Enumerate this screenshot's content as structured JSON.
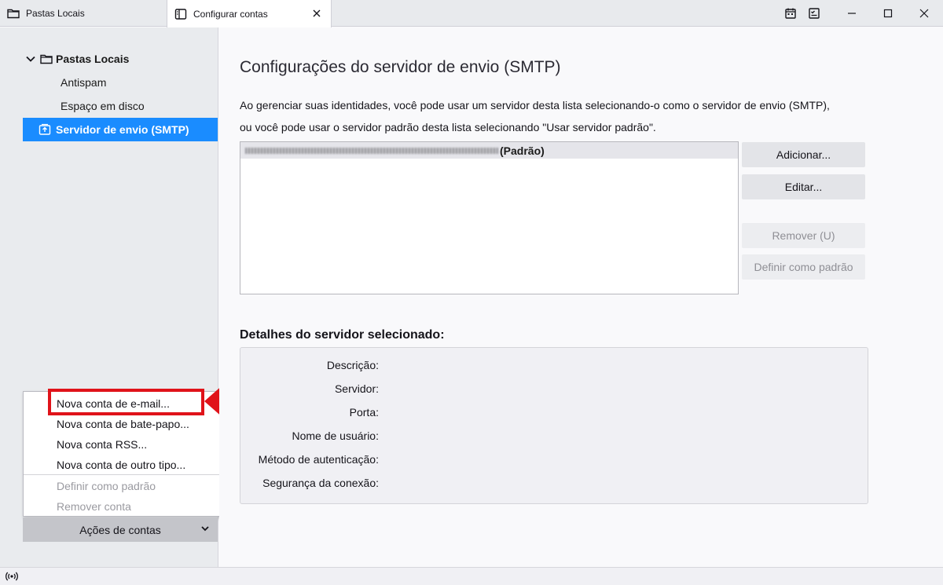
{
  "tabs": [
    {
      "label": "Pastas Locais",
      "icon": "folder-icon"
    },
    {
      "label": "Configurar contas",
      "icon": "settings-page-icon",
      "active": true
    }
  ],
  "window_controls": [
    "calendar-icon",
    "tasks-icon",
    "minimize-icon",
    "maximize-icon",
    "close-icon"
  ],
  "sidebar": {
    "account": "Pastas Locais",
    "items": [
      {
        "label": "Antispam"
      },
      {
        "label": "Espaço em disco"
      },
      {
        "label": "Servidor de envio (SMTP)",
        "selected": true
      }
    ],
    "menu": {
      "items": [
        {
          "label": "Nova conta de e-mail...",
          "enabled": true,
          "highlighted": true
        },
        {
          "label": "Nova conta de bate-papo...",
          "enabled": true
        },
        {
          "label": "Nova conta RSS...",
          "enabled": true
        },
        {
          "label": "Nova conta de outro tipo...",
          "enabled": true
        },
        {
          "label": "Definir como padrão",
          "enabled": false
        },
        {
          "label": "Remover conta",
          "enabled": false
        }
      ]
    },
    "actions_button": "Ações de contas"
  },
  "main": {
    "title": "Configurações do servidor de envio (SMTP)",
    "description_line1": "Ao gerenciar suas identidades, você pode usar um servidor desta lista selecionando-o como o servidor de envio (SMTP),",
    "description_line2": "ou você pode usar o servidor padrão desta lista selecionando \"Usar servidor padrão\".",
    "server_list": [
      {
        "suffix": "(Padrão)",
        "selected": true
      }
    ],
    "buttons": {
      "add": "Adicionar...",
      "edit": "Editar...",
      "remove": "Remover (U)",
      "set_default": "Definir como padrão"
    },
    "details_title": "Detalhes do servidor selecionado:",
    "details_labels": [
      "Descrição:",
      "Servidor:",
      "Porta:",
      "Nome de usuário:",
      "Método de autenticação:",
      "Segurança da conexão:"
    ]
  },
  "colors": {
    "selection": "#1a8cff",
    "highlight_annotation": "#e0131a"
  }
}
